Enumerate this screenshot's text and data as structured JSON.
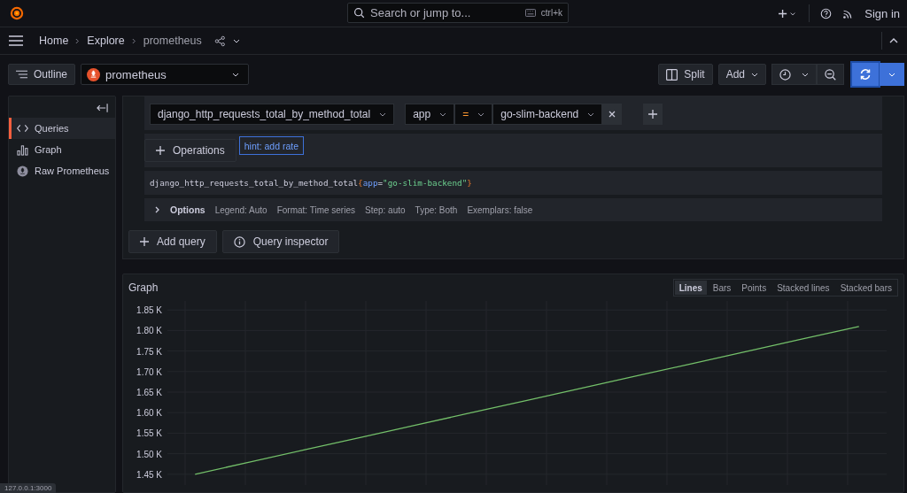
{
  "top_bar": {
    "search": {
      "placeholder": "Search or jump to...",
      "shortcut": "ctrl+k"
    },
    "sign_in": "Sign in"
  },
  "breadcrumbs": [
    {
      "label": "Home",
      "current": false
    },
    {
      "label": "Explore",
      "current": false
    },
    {
      "label": "prometheus",
      "current": true
    }
  ],
  "toolbar": {
    "outline": "Outline",
    "datasource": "prometheus",
    "split": "Split",
    "add": "Add"
  },
  "sidebar": {
    "items": [
      {
        "label": "Queries",
        "kind": "code",
        "selected": true
      },
      {
        "label": "Graph",
        "kind": "graph",
        "selected": false
      },
      {
        "label": "Raw Prometheus",
        "kind": "prometheus",
        "selected": false
      }
    ]
  },
  "query": {
    "metric": "django_http_requests_total_by_method_total",
    "label_filter": {
      "label": "app",
      "operator": "=",
      "value": "go-slim-backend"
    },
    "operations": "Operations",
    "hint": "hint: add rate",
    "code": [
      {
        "text": "django_http_requests_total_by_method_total",
        "kind": "name"
      },
      {
        "text": "{",
        "kind": "brace"
      },
      {
        "text": "app",
        "kind": "label"
      },
      {
        "text": "=",
        "kind": "op"
      },
      {
        "text": "\"go-slim-backend\"",
        "kind": "string"
      },
      {
        "text": "}",
        "kind": "brace"
      }
    ],
    "options": {
      "label": "Options",
      "items": [
        "Legend: Auto",
        "Format: Time series",
        "Step: auto",
        "Type: Both",
        "Exemplars: false"
      ]
    }
  },
  "actions": [
    {
      "label": "Add query",
      "kind": "add"
    },
    {
      "label": "Query inspector",
      "kind": "info"
    }
  ],
  "graph": {
    "title": "Graph",
    "modes": [
      {
        "label": "Lines",
        "selected": true
      },
      {
        "label": "Bars",
        "selected": false
      },
      {
        "label": "Points",
        "selected": false
      },
      {
        "label": "Stacked lines",
        "selected": false
      },
      {
        "label": "Stacked bars",
        "selected": false
      }
    ],
    "chart_data": {
      "type": "line",
      "grid": true,
      "ylim": [
        1428,
        1872
      ],
      "series": [
        {
          "color": "#73bf69",
          "values": [
            1450,
            1480,
            1510,
            1540,
            1570,
            1600,
            1630,
            1660,
            1690,
            1720,
            1750,
            1780,
            1810
          ]
        }
      ],
      "yticks": [
        {
          "value": 1450,
          "label": "1.45 K"
        },
        {
          "value": 1500,
          "label": "1.50 K"
        },
        {
          "value": 1550,
          "label": "1.55 K"
        },
        {
          "value": 1600,
          "label": "1.60 K"
        },
        {
          "value": 1650,
          "label": "1.65 K"
        },
        {
          "value": 1700,
          "label": "1.70 K"
        },
        {
          "value": 1750,
          "label": "1.75 K"
        },
        {
          "value": 1800,
          "label": "1.80 K"
        },
        {
          "value": 1850,
          "label": "1.85 K"
        }
      ]
    }
  },
  "status_url": "127.0.0.1:3000"
}
